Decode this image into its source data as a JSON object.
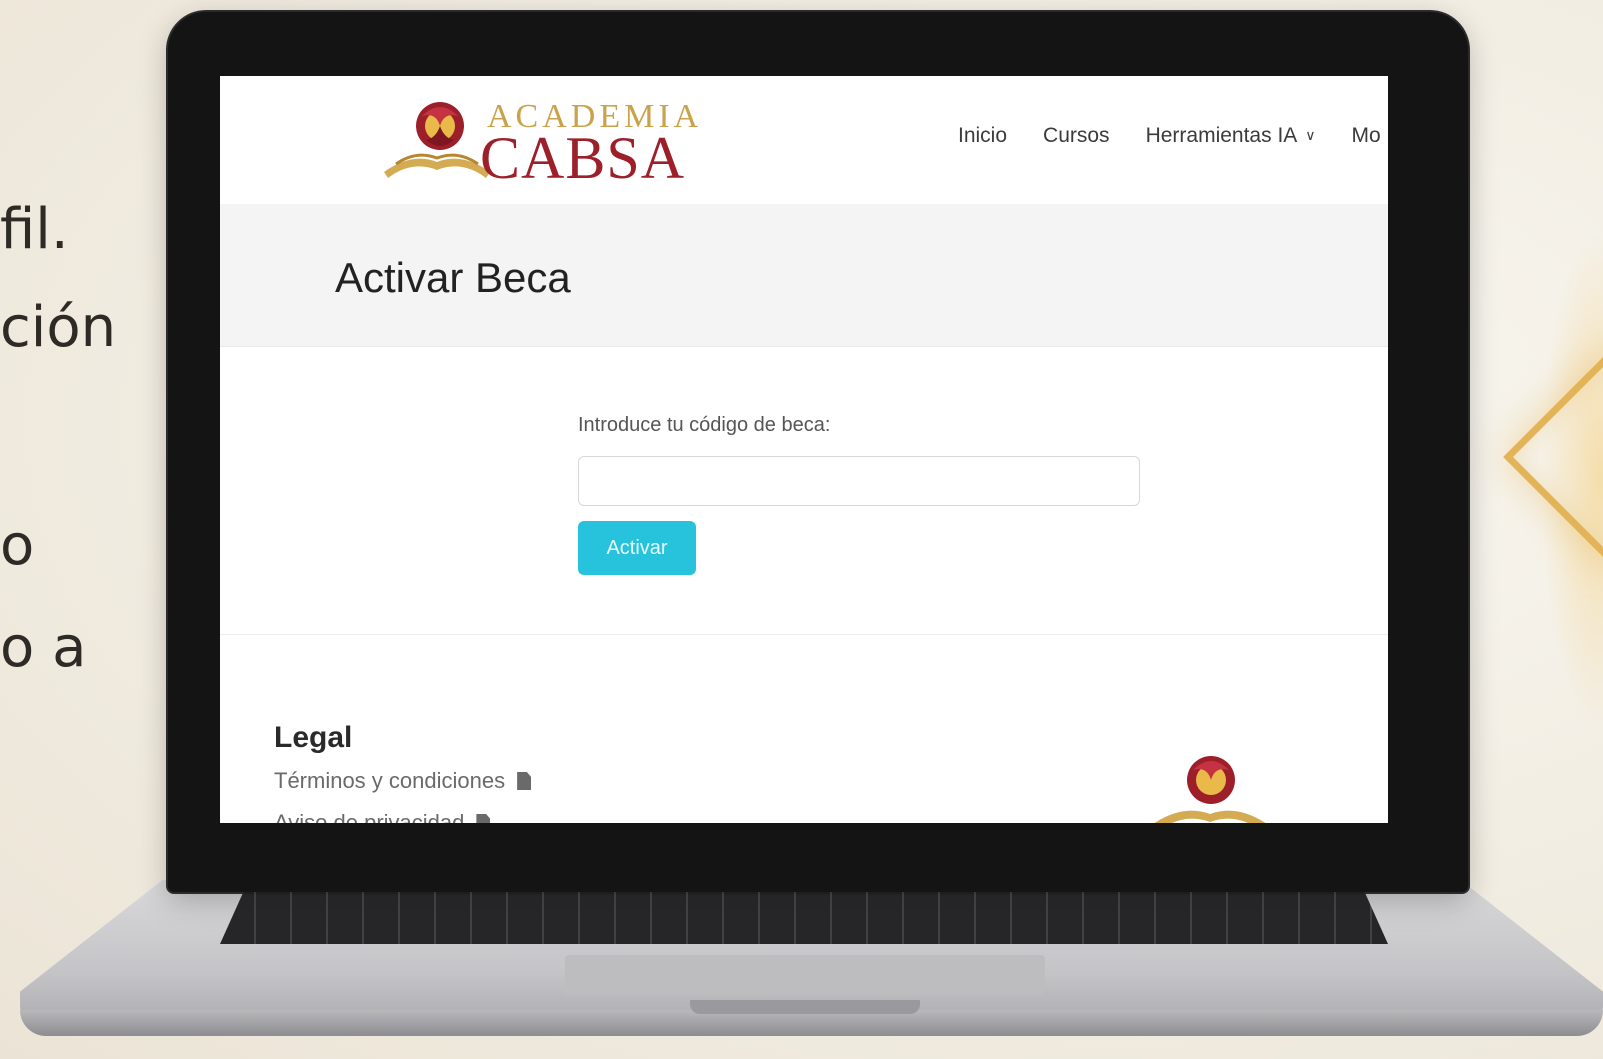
{
  "slide": {
    "fragments": [
      "fil.",
      "ción",
      "o",
      "o a"
    ]
  },
  "site": {
    "logo": {
      "line1": "ACADEMIA",
      "line2": "CABSA"
    },
    "nav": {
      "items": [
        {
          "label": "Inicio"
        },
        {
          "label": "Cursos"
        },
        {
          "label": "Herramientas IA",
          "has_dropdown": true
        },
        {
          "label": "Mo"
        }
      ]
    },
    "page_title": "Activar Beca",
    "form": {
      "label": "Introduce tu código de beca:",
      "input_value": "",
      "input_placeholder": "",
      "button_label": "Activar"
    },
    "footer": {
      "heading": "Legal",
      "links": [
        {
          "label": "Términos y condiciones"
        },
        {
          "label": "Aviso de privacidad"
        }
      ]
    }
  },
  "colors": {
    "brand_gold": "#c9a24a",
    "brand_red": "#9c1f2a",
    "button": "#27c3dc"
  },
  "icons": {
    "chevron": "chevron-down-icon",
    "document": "document-icon"
  }
}
